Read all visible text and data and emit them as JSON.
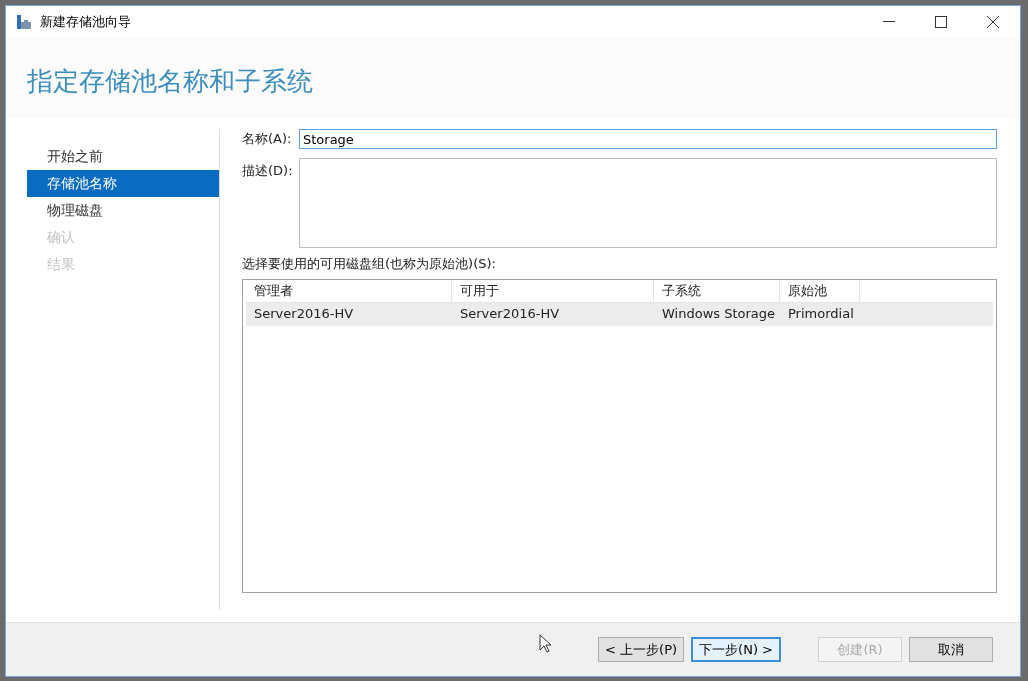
{
  "window": {
    "title": "新建存储池向导"
  },
  "page_title": "指定存储池名称和子系统",
  "steps": [
    {
      "label": "开始之前",
      "selected": false,
      "disabled": false
    },
    {
      "label": "存储池名称",
      "selected": true,
      "disabled": false
    },
    {
      "label": "物理磁盘",
      "selected": false,
      "disabled": false
    },
    {
      "label": "确认",
      "selected": false,
      "disabled": true
    },
    {
      "label": "结果",
      "selected": false,
      "disabled": true
    }
  ],
  "name_field": {
    "label": "名称(A):",
    "value": "Storage"
  },
  "description_field": {
    "label": "描述(D):"
  },
  "pool_list": {
    "label": "选择要使用的可用磁盘组(也称为原始池)(S):",
    "columns": [
      "管理者",
      "可用于",
      "子系统",
      "原始池"
    ],
    "rows": [
      {
        "cells": [
          "Server2016-HV",
          "Server2016-HV",
          "Windows Storage",
          "Primordial"
        ],
        "selected": true
      }
    ]
  },
  "buttons": [
    {
      "label": "< 上一步(P)",
      "disabled": false,
      "default": false
    },
    {
      "label": "下一步(N) >",
      "disabled": false,
      "default": true
    },
    {
      "label": "创建(R)",
      "disabled": true,
      "default": false
    },
    {
      "label": "取消",
      "disabled": false,
      "default": false
    }
  ]
}
